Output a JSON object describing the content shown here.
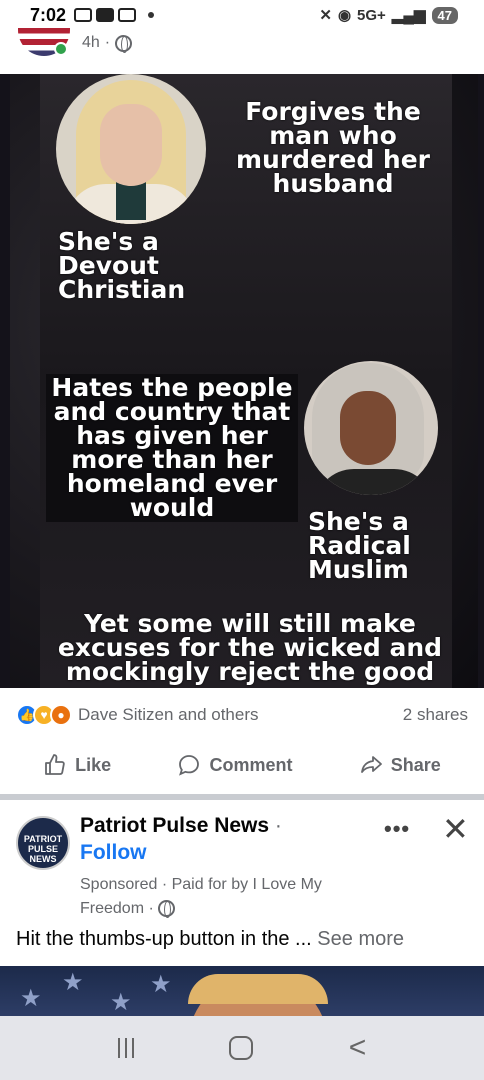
{
  "status_bar": {
    "time": "7:02",
    "network": "5G+",
    "battery": "47"
  },
  "post": {
    "time_ago": "4h",
    "visibility_icon": "globe-icon",
    "meme": {
      "top_right_text": "Forgives the man who murdered her husband",
      "top_left_label": "She's a Devout Christian",
      "middle_left_text": "Hates the people and country that has given her more than her homeland ever would",
      "bottom_right_label": "She's a Radical Muslim",
      "bottom_caption": "Yet some will still make excuses for the wicked and mockingly reject the good"
    },
    "reactions": {
      "names": "Dave Sitizen and others",
      "shares": "2 shares"
    },
    "actions": {
      "like": "Like",
      "comment": "Comment",
      "share": "Share"
    }
  },
  "ad": {
    "page_name": "Patriot Pulse News",
    "name_separator": "·",
    "follow": "Follow",
    "logo_text": "PATRIOT PULSE NEWS",
    "sponsored_line": "Sponsored · Paid for by I Love My Freedom ·",
    "more_label": "•••",
    "close_label": "✕",
    "body_text": "Hit the thumbs-up button in the ...",
    "see_more": "See more"
  }
}
